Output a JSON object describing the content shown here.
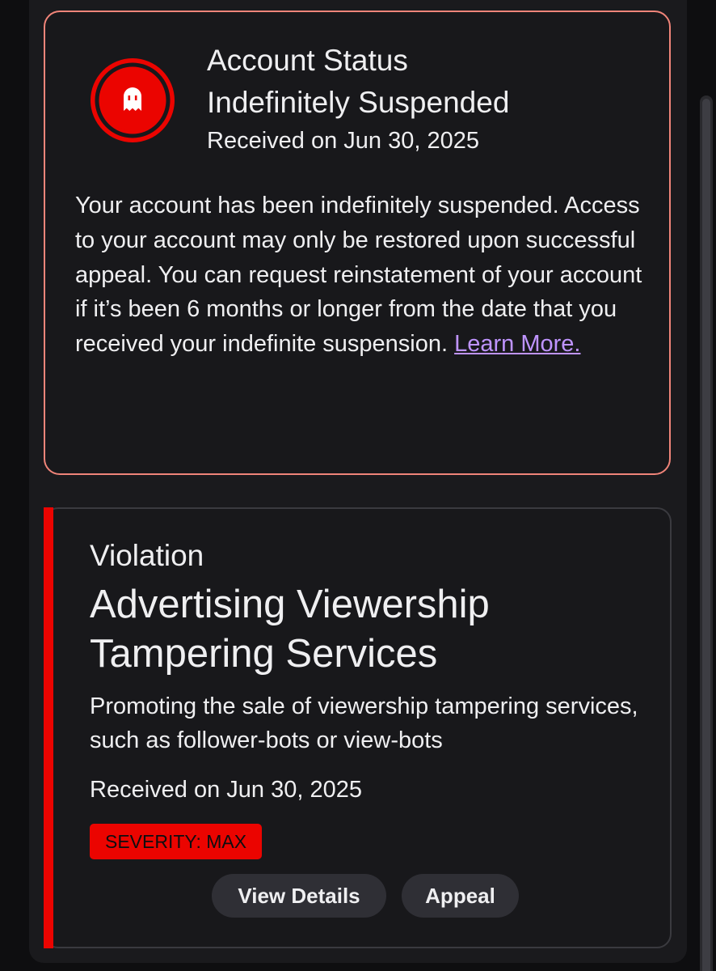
{
  "status": {
    "title": "Account Status",
    "state": "Indefinitely Suspended",
    "date": "Received on Jun 30, 2025",
    "body": "Your account has been indefinitely suspended. Access to your account may only be restored upon successful appeal. You can request reinstatement of your account if it’s been 6 months or longer from the date that you received your indefinite suspension. ",
    "link": "Learn More.",
    "icon": "ghost-icon",
    "border_color": "#f08479",
    "icon_color": "#eb0400"
  },
  "violation": {
    "label": "Violation",
    "title": "Advertising Viewership Tampering Services",
    "description": "Promoting the sale of viewership tampering services, such as follower-bots or view-bots",
    "date": "Received on Jun 30, 2025",
    "severity": "SEVERITY: MAX",
    "accent_color": "#eb0400",
    "buttons": {
      "details": "View Details",
      "appeal": "Appeal"
    }
  }
}
